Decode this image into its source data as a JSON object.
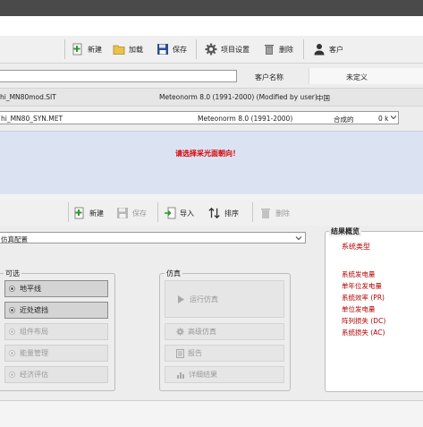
{
  "top_toolbar": {
    "new_label": "新建",
    "load_label": "加载",
    "save_label": "保存",
    "settings_label": "项目设置",
    "delete_label": "删除",
    "customer_label": "客户"
  },
  "project_info": {
    "customer_name_label": "客户名称",
    "customer_name_value": "未定义"
  },
  "site_row": {
    "file": "hi_MN80mod.SIT",
    "source": "Meteonorm 8.0 (1991-2000) (Modified by user)",
    "country": "中国"
  },
  "meteo_row": {
    "file": "hi_MN80_SYN.MET",
    "source": "Meteonorm 8.0 (1991-2000)",
    "type_label": "合成的",
    "distance": "0 k"
  },
  "warning": {
    "text": "请选择采光面朝向！"
  },
  "variant_toolbar": {
    "new_label": "新建",
    "save_label": "保存",
    "import_label": "导入",
    "sort_label": "排序",
    "delete_label": "删除"
  },
  "variant_select": {
    "value": "仿真配置"
  },
  "optional_panel": {
    "title": "可选",
    "items": [
      {
        "label": "地平线",
        "enabled": true
      },
      {
        "label": "近处遮挡",
        "enabled": true
      },
      {
        "label": "组件布局",
        "enabled": false
      },
      {
        "label": "能量管理",
        "enabled": false
      },
      {
        "label": "经济评估",
        "enabled": false
      }
    ]
  },
  "simulation_panel": {
    "title": "仿真",
    "run_label": "运行仿真",
    "advanced_label": "高级仿真",
    "report_label": "报告",
    "detailed_label": "详细结果"
  },
  "results_panel": {
    "title": "结果概览",
    "system_type_label": "系统类型",
    "lines": [
      "系统发电量",
      "单年位发电量",
      "系统效率 (PR)",
      "单位发电量",
      "阵列损失 (DC)",
      "系统损失 (AC)"
    ]
  },
  "colors": {
    "warning_bg": "#dbe3f3",
    "warning_text": "#d40000",
    "results_text": "#b00000",
    "toolbar_bg": "#f0f0f0"
  }
}
